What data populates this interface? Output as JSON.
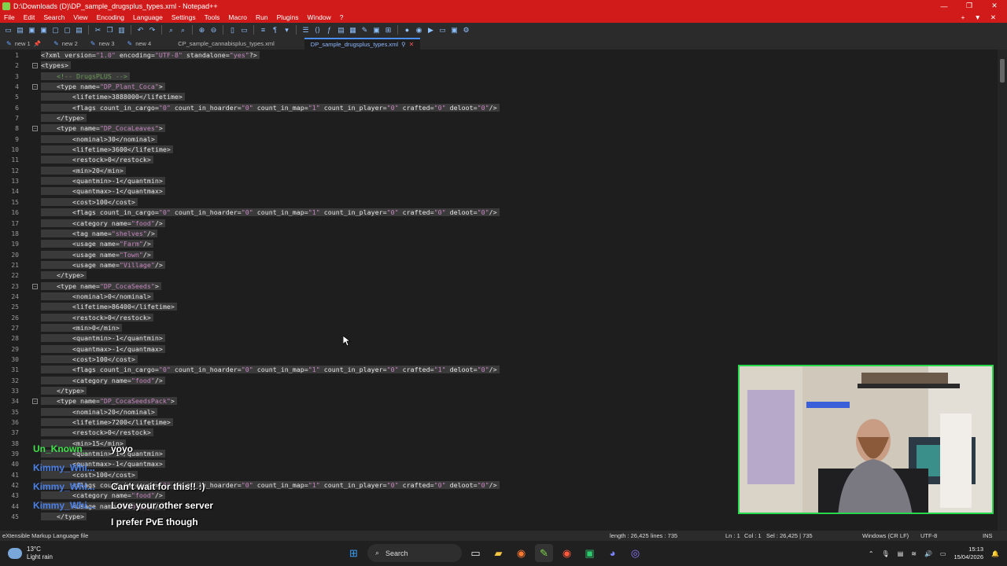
{
  "window": {
    "title": "D:\\Downloads (D)\\DP_sample_drugsplus_types.xml - Notepad++",
    "minimize": "—",
    "maximize": "❐",
    "close": "✕"
  },
  "menu": [
    "File",
    "Edit",
    "Search",
    "View",
    "Encoding",
    "Language",
    "Settings",
    "Tools",
    "Macro",
    "Run",
    "Plugins",
    "Window",
    "?"
  ],
  "menu_right": [
    "+",
    "▼",
    "✕"
  ],
  "tabs": [
    {
      "label": "new 1",
      "active": false
    },
    {
      "label": "new 2",
      "active": false
    },
    {
      "label": "new 3",
      "active": false
    },
    {
      "label": "new 4",
      "active": false
    },
    {
      "label": "CP_sample_cannabisplus_types.xml",
      "active": false
    },
    {
      "label": "DP_sample_drugsplus_types.xml",
      "active": true
    }
  ],
  "code_lines": [
    "<?xml version=\"1.0\" encoding=\"UTF-8\" standalone=\"yes\"?>",
    "<types>",
    "    <!-- DrugsPLUS -->",
    "    <type name=\"DP_Plant_Coca\">",
    "        <lifetime>3888000</lifetime>",
    "        <flags count_in_cargo=\"0\" count_in_hoarder=\"0\" count_in_map=\"1\" count_in_player=\"0\" crafted=\"0\" deloot=\"0\"/>",
    "    </type>",
    "    <type name=\"DP_CocaLeaves\">",
    "        <nominal>30</nominal>",
    "        <lifetime>3600</lifetime>",
    "        <restock>0</restock>",
    "        <min>20</min>",
    "        <quantmin>-1</quantmin>",
    "        <quantmax>-1</quantmax>",
    "        <cost>100</cost>",
    "        <flags count_in_cargo=\"0\" count_in_hoarder=\"0\" count_in_map=\"1\" count_in_player=\"0\" crafted=\"0\" deloot=\"0\"/>",
    "        <category name=\"food\"/>",
    "        <tag name=\"shelves\"/>",
    "        <usage name=\"Farm\"/>",
    "        <usage name=\"Town\"/>",
    "        <usage name=\"Village\"/>",
    "    </type>",
    "    <type name=\"DP_CocaSeeds\">",
    "        <nominal>0</nominal>",
    "        <lifetime>86400</lifetime>",
    "        <restock>0</restock>",
    "        <min>0</min>",
    "        <quantmin>-1</quantmin>",
    "        <quantmax>-1</quantmax>",
    "        <cost>100</cost>",
    "        <flags count_in_cargo=\"0\" count_in_hoarder=\"0\" count_in_map=\"1\" count_in_player=\"0\" crafted=\"1\" deloot=\"0\"/>",
    "        <category name=\"food\"/>",
    "    </type>",
    "    <type name=\"DP_CocaSeedsPack\">",
    "        <nominal>20</nominal>",
    "        <lifetime>7200</lifetime>",
    "        <restock>0</restock>",
    "        <min>15</min>",
    "        <quantmin>-1</quantmin>",
    "        <quantmax>-1</quantmax>",
    "        <cost>100</cost>",
    "        <flags count_in_cargo=\"0\" count_in_hoarder=\"0\" count_in_map=\"1\" count_in_player=\"0\" crafted=\"0\" deloot=\"0\"/>",
    "        <category name=\"food\"/>",
    "        <usage name=\"Hunting\"/>",
    "    </type>"
  ],
  "fold_lines": [
    2,
    4,
    8,
    23,
    34
  ],
  "status": {
    "filetype": "eXtensible Markup Language file",
    "length": "length : 26,425",
    "lines": "lines : 735",
    "position": "Ln : 1",
    "col": "Col : 1",
    "sel": "Sel : 26,425 | 735",
    "eol": "Windows (CR LF)",
    "encoding": "UTF-8",
    "mode": "INS"
  },
  "taskbar": {
    "temp": "13°C",
    "weather": "Light rain",
    "search": "Search",
    "time": "15:13",
    "date": "15/04/2026"
  },
  "chat": [
    {
      "user": "Un_Known_",
      "color": "#3fe04a",
      "message": "yoyo"
    },
    {
      "user": "Kimmy_Whi...",
      "color": "#4a7fe8",
      "message": ""
    },
    {
      "user": "Kimmy_Whi...",
      "color": "#4a7fe8",
      "message": "Can't wait for this!! :)"
    },
    {
      "user": "Kimmy_Whi...",
      "color": "#4a7fe8",
      "message": "Love your other server"
    },
    {
      "user": "",
      "color": "#4a7fe8",
      "message": "I prefer PvE though"
    }
  ]
}
